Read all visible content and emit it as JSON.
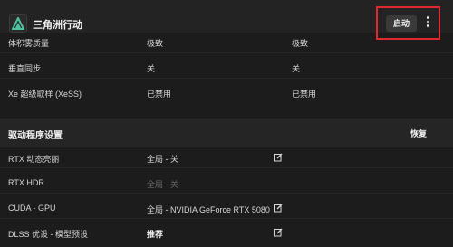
{
  "app": {
    "title": "三角洲行动",
    "launch_label": "启动"
  },
  "settings_rows": [
    {
      "name": "体积雾质量",
      "value": "极致",
      "value2": "极致"
    },
    {
      "name": "垂直同步",
      "value": "关",
      "value2": "关"
    },
    {
      "name": "Xe 超级取样 (XeSS)",
      "value": "已禁用",
      "value2": "已禁用"
    }
  ],
  "driver_section": {
    "title": "驱动程序设置",
    "restore_label": "恢复",
    "rows": [
      {
        "name": "RTX 动态亮丽",
        "value": "全局 - 关"
      },
      {
        "name": "RTX HDR",
        "value": "全局 - 关"
      },
      {
        "name": "CUDA - GPU",
        "value": "全局 - NVIDIA GeForce RTX 5080"
      },
      {
        "name": "DLSS 优设 - 模型预设",
        "value": "推荐"
      }
    ]
  },
  "colors": {
    "accent": "#4fc3a1",
    "highlight": "#e0282e"
  }
}
